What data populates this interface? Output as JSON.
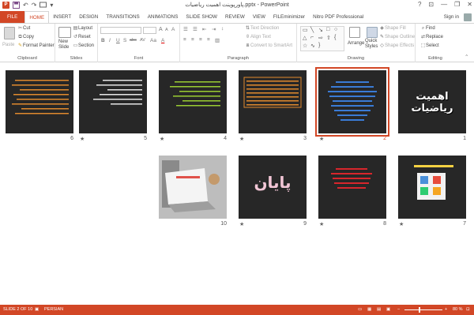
{
  "window": {
    "title": "پاورپوینت اهمیت ریاضیات.pptx - PowerPoint",
    "help": "?",
    "controls": [
      "⊡",
      "—",
      "❐",
      "✕"
    ]
  },
  "qat": {
    "app_icon": "P",
    "undo": "↶",
    "redo": "↷",
    "customize": "▾"
  },
  "tabs": [
    "FILE",
    "HOME",
    "INSERT",
    "DESIGN",
    "TRANSITIONS",
    "ANIMATIONS",
    "SLIDE SHOW",
    "REVIEW",
    "VIEW",
    "FILEminimizer",
    "Nitro PDF Professional"
  ],
  "active_tab": "HOME",
  "account": {
    "label": "Sign in"
  },
  "ribbon": {
    "clipboard": {
      "paste": "Paste",
      "cut": "Cut",
      "copy": "Copy",
      "format_painter": "Format Painter",
      "label": "Clipboard"
    },
    "slides": {
      "new_slide_line1": "New",
      "new_slide_line2": "Slide",
      "layout": "Layout",
      "reset": "Reset",
      "section": "Section",
      "label": "Slides"
    },
    "font": {
      "bold": "B",
      "italic": "I",
      "underline": "U",
      "shadow": "S",
      "strike": "abc",
      "spacing": "AV",
      "case": "Aa",
      "color": "A",
      "grow": "A",
      "shrink": "A",
      "clear": "A",
      "label": "Font"
    },
    "paragraph": {
      "text_direction": "Text Direction",
      "align_text": "Align Text",
      "convert_smartart": "Convert to SmartArt",
      "label": "Paragraph"
    },
    "drawing": {
      "arrange": "Arrange",
      "quick_styles_line1": "Quick",
      "quick_styles_line2": "Styles",
      "shape_fill": "Shape Fill",
      "shape_outline": "Shape Outline",
      "shape_effects": "Shape Effects",
      "label": "Drawing"
    },
    "editing": {
      "find": "Find",
      "replace": "Replace",
      "select": "Select",
      "label": "Editing"
    }
  },
  "slides": [
    {
      "number": "1",
      "star": "",
      "title_text": "اهمیت ریاضیات"
    },
    {
      "number": "2",
      "star": "★",
      "selected": true
    },
    {
      "number": "3",
      "star": "★"
    },
    {
      "number": "4",
      "star": "★"
    },
    {
      "number": "5",
      "star": "★"
    },
    {
      "number": "6",
      "star": ""
    },
    {
      "number": "7",
      "star": "★"
    },
    {
      "number": "8",
      "star": "★"
    },
    {
      "number": "9",
      "star": "★",
      "title_text": "پایان"
    },
    {
      "number": "10",
      "star": ""
    }
  ],
  "statusbar": {
    "slide_info": "SLIDE 2 OF 10",
    "language": "PERSIAN",
    "zoom": "80 %",
    "zoom_level": 0.8
  },
  "colors": {
    "accent": "#d24726",
    "slide_bg": "#272727"
  }
}
